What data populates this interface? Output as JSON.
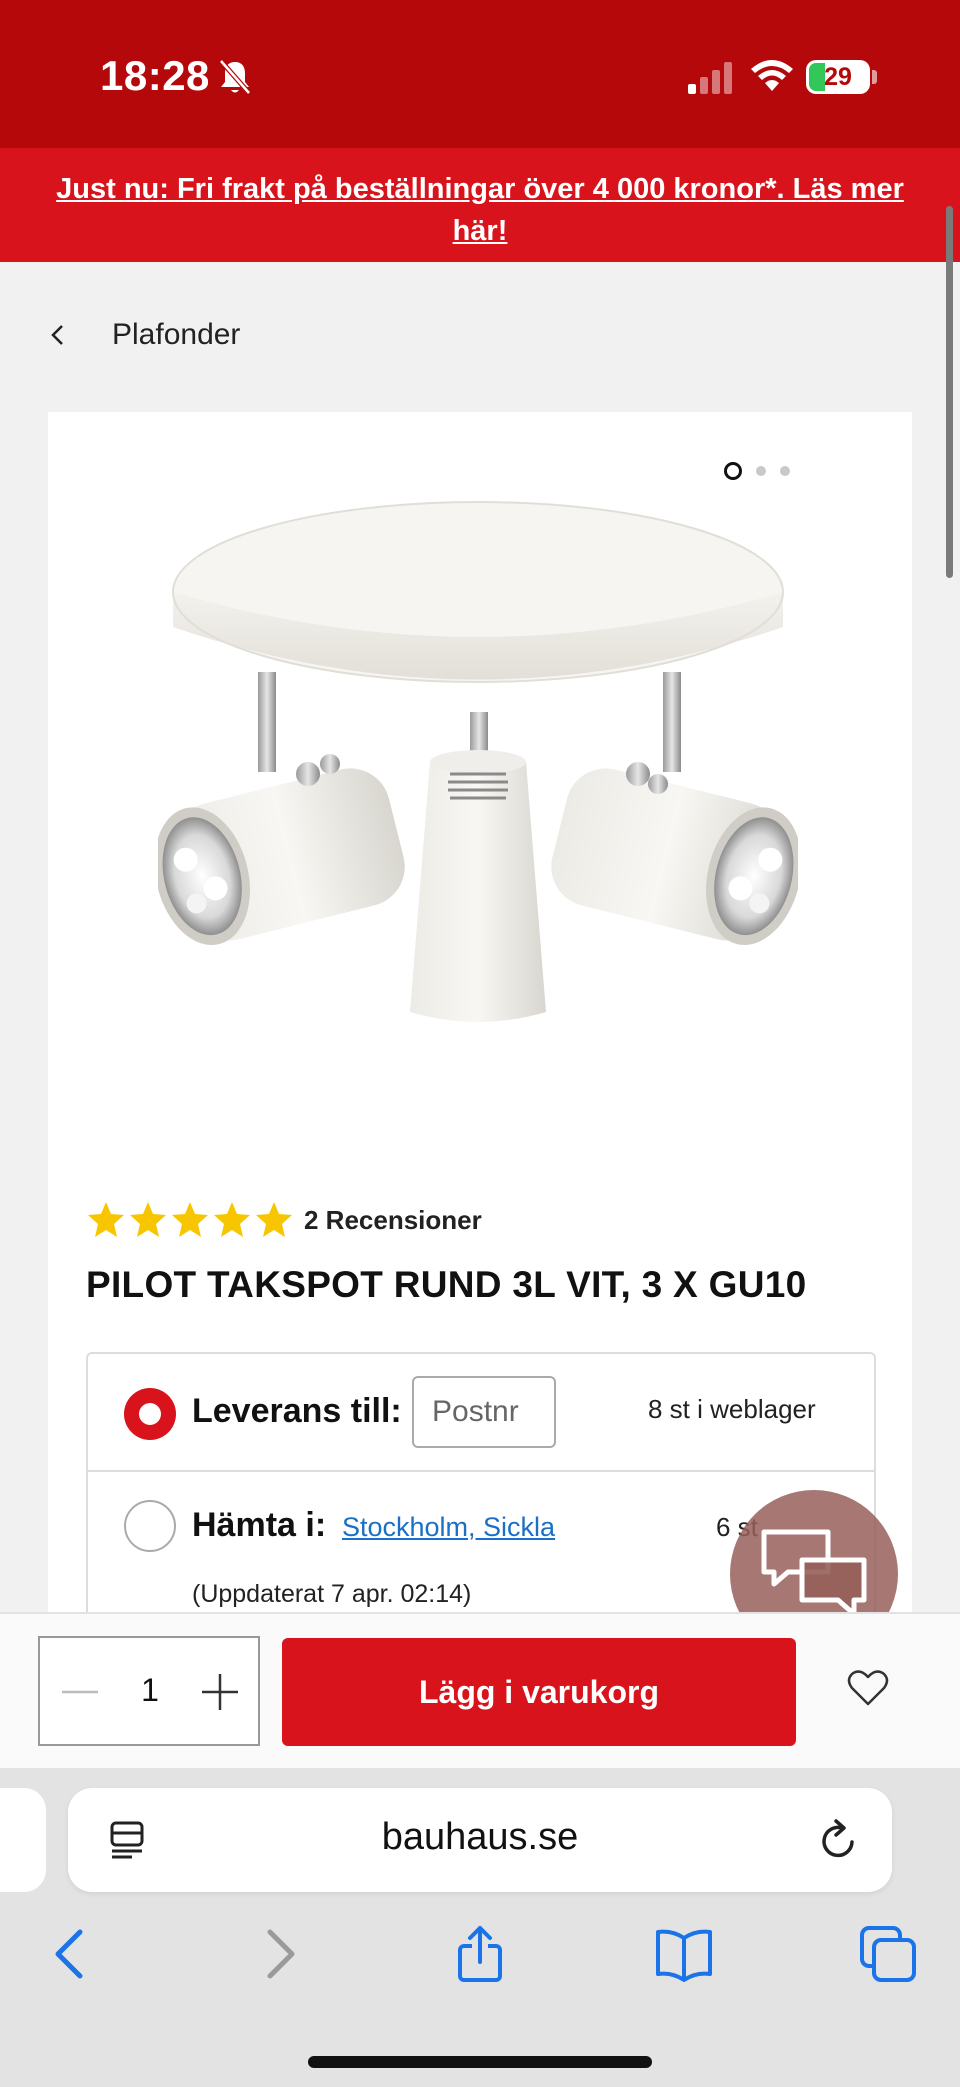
{
  "status_bar": {
    "time": "18:28",
    "battery": "29",
    "icons": [
      "bell-slash-icon",
      "signal-icon",
      "wifi-icon",
      "battery-charging-icon"
    ]
  },
  "promo": {
    "text": "Just nu: Fri frakt på beställningar över 4 000 kronor*. Läs mer här!"
  },
  "breadcrumb": {
    "label": "Plafonder"
  },
  "gallery": {
    "image_count": 3,
    "active_index": 0
  },
  "product": {
    "rating": 5,
    "rating_max": 5,
    "reviews_label": "2 Recensioner",
    "title": "PILOT TAKSPOT RUND 3L VIT, 3 X GU10"
  },
  "delivery": {
    "option1_label": "Leverans till:",
    "postnr_placeholder": "Postnr",
    "option1_stock": "8 st i weblager",
    "option2_label": "Hämta i:",
    "store_name": "Stockholm, Sickla",
    "option2_stock": "6 st",
    "updated": "(Uppdaterat 7 apr. 02:14)",
    "selected": "delivery"
  },
  "cart": {
    "quantity": "1",
    "add_label": "Lägg i varukorg"
  },
  "browser": {
    "url": "bauhaus.se"
  },
  "colors": {
    "brand_red": "#d8131b",
    "status_red": "#b5080b",
    "star_yellow": "#f7c600",
    "link_blue": "#1a6fc6",
    "ios_blue": "#1a73e8"
  }
}
